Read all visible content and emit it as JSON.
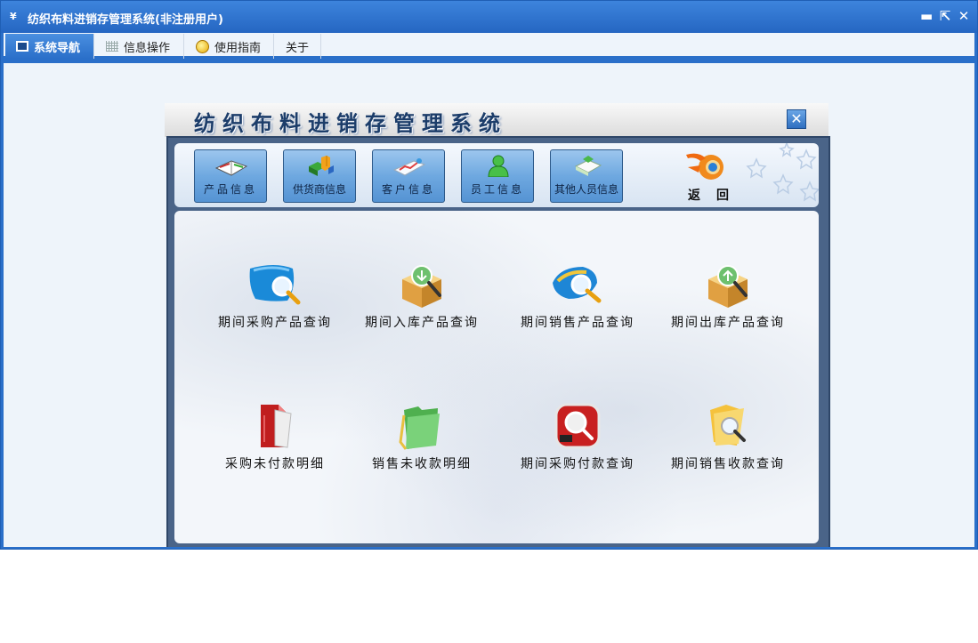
{
  "window": {
    "title": "纺织布料进销存管理系统(非注册用户)",
    "app_icon_glyph": "¥"
  },
  "window_controls": {
    "minimize": "▬",
    "restore": "⇱",
    "close": "✕"
  },
  "menu": {
    "tabs": [
      {
        "label": "系统导航",
        "icon": "screen-icon",
        "active": true
      },
      {
        "label": "信息操作",
        "icon": "grid-icon"
      },
      {
        "label": "使用指南",
        "icon": "help-icon"
      },
      {
        "label": "关于"
      }
    ]
  },
  "panel": {
    "title": "纺织布料进销存管理系统",
    "close_glyph": "✕"
  },
  "toolbar": {
    "buttons": [
      {
        "label": "产品信息",
        "icon": "book-icon"
      },
      {
        "label": "供货商信息",
        "icon": "blocks-icon"
      },
      {
        "label": "客户信息",
        "icon": "graph-icon"
      },
      {
        "label": "员工信息",
        "icon": "person-icon"
      },
      {
        "label": "其他人员信息",
        "icon": "card-icon"
      }
    ],
    "back_label": "返回"
  },
  "functions": [
    {
      "label": "期间采购产品查询",
      "icon": "blue-magnifier-icon"
    },
    {
      "label": "期间入库产品查询",
      "icon": "box-down-magnifier-icon"
    },
    {
      "label": "期间销售产品查询",
      "icon": "blue-gold-magnifier-icon"
    },
    {
      "label": "期间出库产品查询",
      "icon": "box-up-magnifier-icon"
    },
    {
      "label": "采购未付款明细",
      "icon": "red-document-icon"
    },
    {
      "label": "销售未收款明细",
      "icon": "green-folder-icon"
    },
    {
      "label": "期间采购付款查询",
      "icon": "red-search-icon"
    },
    {
      "label": "期间销售收款查询",
      "icon": "yellow-folder-search-icon"
    }
  ],
  "colors": {
    "title_bar": "#2a6fc9",
    "panel_frame": "#4a6488",
    "tool_button": "#6ea8e0"
  }
}
